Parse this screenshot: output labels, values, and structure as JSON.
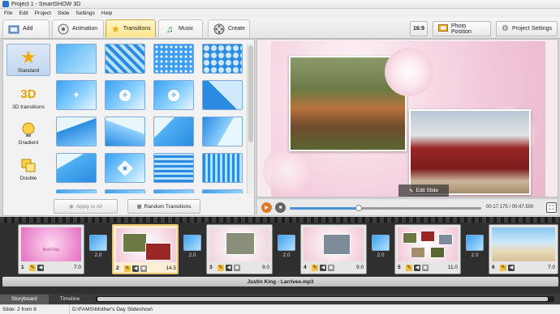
{
  "window": {
    "title": "Project 1 - SmartSHOW 3D"
  },
  "menu": [
    "File",
    "Edit",
    "Project",
    "Slide",
    "Settings",
    "Help"
  ],
  "toolbar": {
    "tabs": [
      {
        "label": "Add",
        "icon": "add-icon"
      },
      {
        "label": "Animation",
        "icon": "animation-icon"
      },
      {
        "label": "Transitions",
        "icon": "star-icon"
      },
      {
        "label": "Music",
        "icon": "music-icon"
      },
      {
        "label": "Create",
        "icon": "film-reel-icon"
      }
    ],
    "aspect_label": "16:9",
    "photo_position_label": "Photo Position",
    "project_settings_label": "Project Settings"
  },
  "transitions_panel": {
    "categories": [
      {
        "label": "Standard",
        "icon": "star-icon"
      },
      {
        "label": "3D transitions",
        "icon": "3d-icon"
      },
      {
        "label": "Gradient",
        "icon": "gradient-bulb-icon"
      },
      {
        "label": "Double",
        "icon": "double-icon"
      }
    ],
    "apply_to_all_label": "Apply to All",
    "random_transitions_label": "Random Transitions"
  },
  "preview": {
    "edit_slide_label": "Edit Slide",
    "time_current": "00:17.175",
    "time_total": "00:47.500",
    "time_separator": "/",
    "position_fraction": 0.36
  },
  "storyboard": {
    "slides": [
      {
        "number": "1",
        "duration": "7.0",
        "title_text": "Best Day"
      },
      {
        "number": "2",
        "duration": "14.5",
        "title_text": ""
      },
      {
        "number": "3",
        "duration": "9.0",
        "title_text": ""
      },
      {
        "number": "4",
        "duration": "9.0",
        "title_text": ""
      },
      {
        "number": "5",
        "duration": "11.0",
        "title_text": ""
      },
      {
        "number": "6",
        "duration": "7.0",
        "title_text": ""
      }
    ],
    "transitions": [
      "2.0",
      "2.0",
      "2.0",
      "2.0",
      "2.0"
    ],
    "audio_track": "Justin King - Larrivee.mp3",
    "view_tabs": [
      "Storyboard",
      "Timeline"
    ]
  },
  "status": {
    "slide_info": "Slide: 2 from 6",
    "path": "D:\\FAMS\\Mother's Day Slideshow\\"
  },
  "colors": {
    "accent_blue": "#4d8fd8",
    "active_tab": "#ffe58a",
    "play_orange": "#e07a2a"
  }
}
